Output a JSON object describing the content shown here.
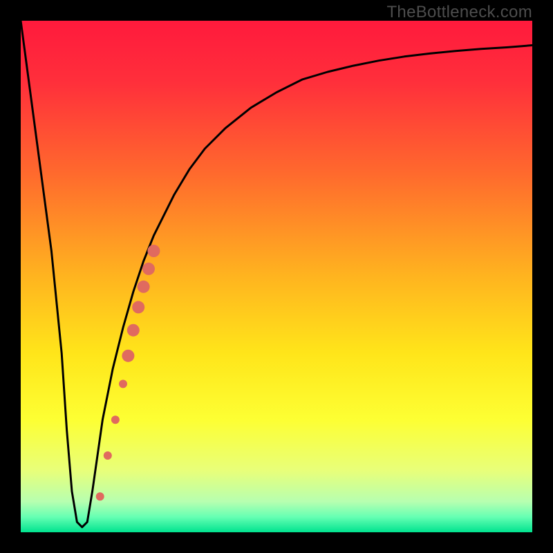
{
  "watermark": "TheBottleneck.com",
  "chart_data": {
    "type": "line",
    "title": "",
    "xlabel": "",
    "ylabel": "",
    "xlim": [
      0,
      100
    ],
    "ylim": [
      0,
      100
    ],
    "gradient_stops": [
      {
        "offset": 0.0,
        "color": "#ff1a3c"
      },
      {
        "offset": 0.12,
        "color": "#ff2f3b"
      },
      {
        "offset": 0.3,
        "color": "#ff6a2d"
      },
      {
        "offset": 0.5,
        "color": "#ffb41f"
      },
      {
        "offset": 0.65,
        "color": "#ffe51a"
      },
      {
        "offset": 0.78,
        "color": "#fdff33"
      },
      {
        "offset": 0.88,
        "color": "#e8ff7a"
      },
      {
        "offset": 0.94,
        "color": "#b7ffb0"
      },
      {
        "offset": 0.97,
        "color": "#66ffb3"
      },
      {
        "offset": 1.0,
        "color": "#00e38f"
      }
    ],
    "series": [
      {
        "name": "bottleneck-curve",
        "x": [
          0,
          2,
          4,
          6,
          8,
          9,
          10,
          11,
          12,
          13,
          14,
          15,
          16,
          18,
          20,
          22,
          24,
          26,
          28,
          30,
          33,
          36,
          40,
          45,
          50,
          55,
          60,
          65,
          70,
          75,
          80,
          85,
          90,
          95,
          100
        ],
        "y": [
          100,
          85,
          70,
          55,
          35,
          20,
          8,
          2,
          1,
          2,
          8,
          15,
          22,
          32,
          40,
          47,
          53,
          58,
          62,
          66,
          71,
          75,
          79,
          83,
          86,
          88.5,
          90,
          91.2,
          92.2,
          93,
          93.6,
          94.1,
          94.5,
          94.8,
          95.2
        ]
      }
    ],
    "markers": [
      {
        "x": 15.5,
        "y": 7,
        "r": 6
      },
      {
        "x": 17.0,
        "y": 15,
        "r": 6
      },
      {
        "x": 18.5,
        "y": 22,
        "r": 6
      },
      {
        "x": 20.0,
        "y": 29,
        "r": 6
      },
      {
        "x": 21.0,
        "y": 34.5,
        "r": 9
      },
      {
        "x": 22.0,
        "y": 39.5,
        "r": 9
      },
      {
        "x": 23.0,
        "y": 44.0,
        "r": 9
      },
      {
        "x": 24.0,
        "y": 48.0,
        "r": 9
      },
      {
        "x": 25.0,
        "y": 51.5,
        "r": 9
      },
      {
        "x": 26.0,
        "y": 55.0,
        "r": 9
      }
    ],
    "marker_color": "#e06a5f"
  }
}
